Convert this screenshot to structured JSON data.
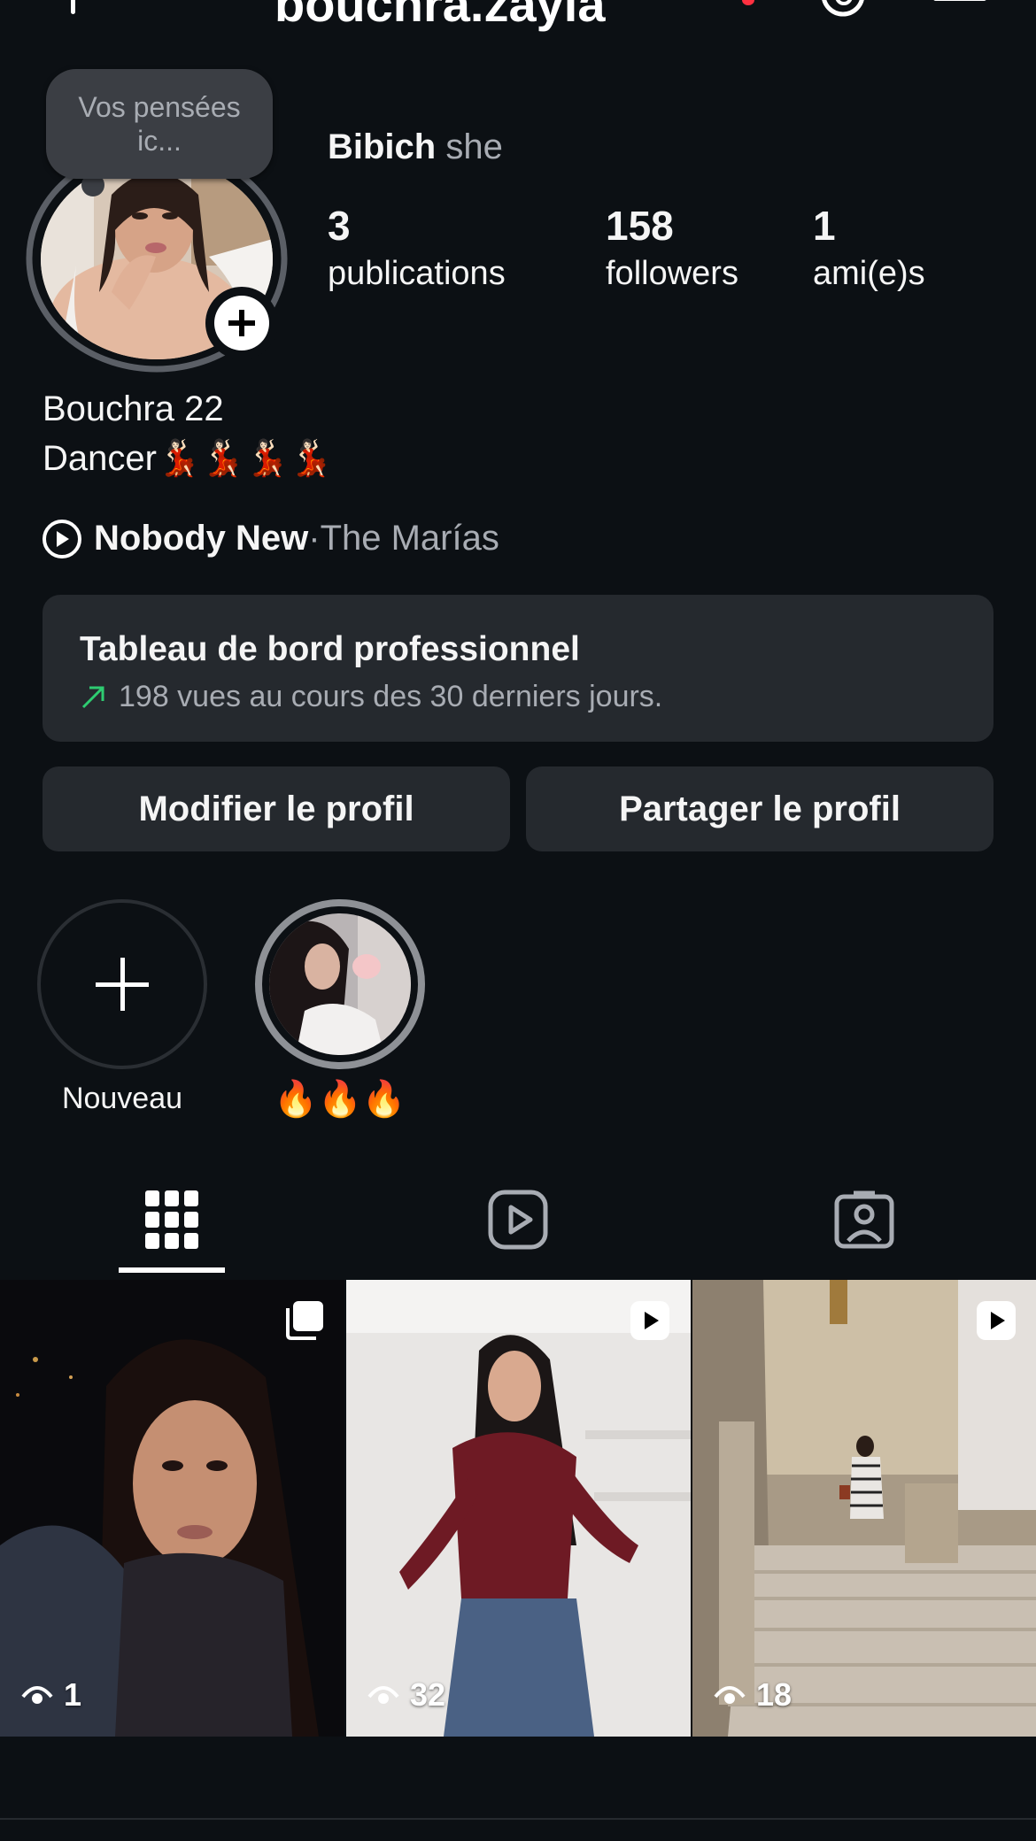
{
  "header": {
    "username": "bouchra.zayla",
    "add_icon": "plus-icon",
    "threads_icon": "threads-icon",
    "menu_icon": "hamburger-menu-icon",
    "notification_color": "#ff3040"
  },
  "profile": {
    "note_placeholder": "Vos pensées ic...",
    "display_name": "Bibich",
    "pronoun": "she",
    "stats": [
      {
        "value": "3",
        "label": "publications"
      },
      {
        "value": "158",
        "label": "followers"
      },
      {
        "value": "1",
        "label": "ami(e)s"
      }
    ],
    "bio_line1": "Bouchra 22",
    "bio_line2": "Dancer💃🏻💃🏻💃🏻💃🏻"
  },
  "music": {
    "song": "Nobody New",
    "separator": " · ",
    "artist": "The Marías"
  },
  "dashboard": {
    "title": "Tableau de bord professionnel",
    "subtitle": "198 vues au cours des 30 derniers jours.",
    "trend_color": "#2ecc71"
  },
  "buttons": {
    "edit": "Modifier le profil",
    "share": "Partager le profil"
  },
  "highlights": [
    {
      "label": "Nouveau"
    },
    {
      "label": "🔥🔥🔥"
    }
  ],
  "tabs": [
    {
      "icon": "grid-icon",
      "active": true
    },
    {
      "icon": "reels-icon",
      "active": false
    },
    {
      "icon": "tagged-icon",
      "active": false
    }
  ],
  "posts": [
    {
      "type_icon": "carousel-icon",
      "views": "1"
    },
    {
      "type_icon": "reel-icon",
      "views": "32"
    },
    {
      "type_icon": "reel-icon",
      "views": "18"
    }
  ]
}
